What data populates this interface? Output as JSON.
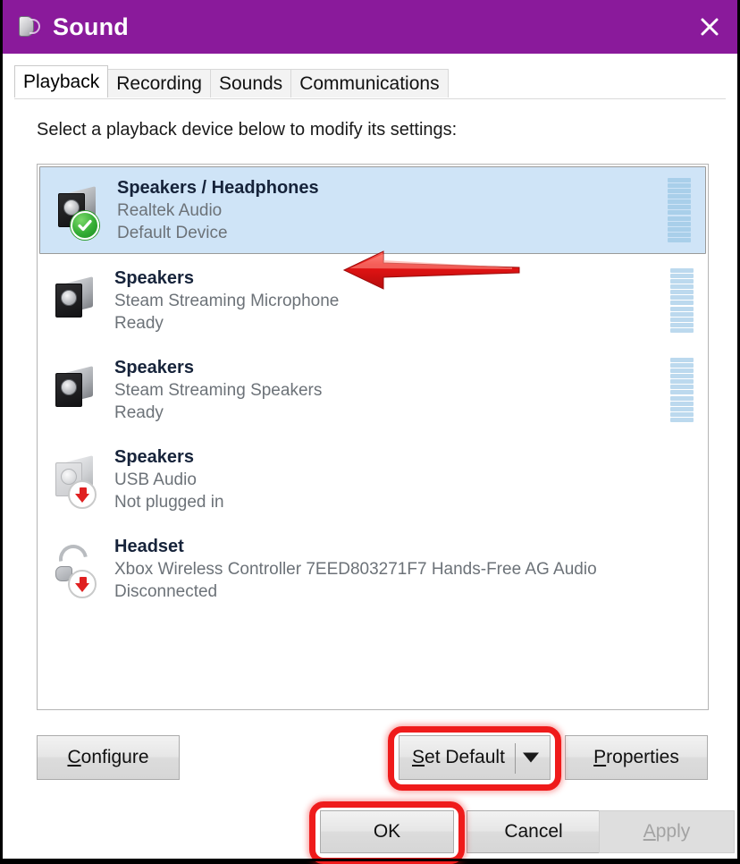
{
  "window": {
    "title": "Sound",
    "icon": "speaker-icon",
    "close_label": "✕",
    "accent_color": "#8a1a9b"
  },
  "tabs": [
    {
      "label": "Playback",
      "active": true
    },
    {
      "label": "Recording",
      "active": false
    },
    {
      "label": "Sounds",
      "active": false
    },
    {
      "label": "Communications",
      "active": false
    }
  ],
  "instruction": "Select a playback device below to modify its settings:",
  "devices": [
    {
      "name": "Speakers / Headphones",
      "driver": "Realtek Audio",
      "status": "Default Device",
      "icon": "speaker-icon",
      "badge": "green-check-icon",
      "selected": true,
      "meter_level": 12,
      "meter_strong": true
    },
    {
      "name": "Speakers",
      "driver": "Steam Streaming Microphone",
      "status": "Ready",
      "icon": "speaker-icon",
      "badge": "none",
      "selected": false,
      "meter_level": 12,
      "meter_strong": false
    },
    {
      "name": "Speakers",
      "driver": "Steam Streaming Speakers",
      "status": "Ready",
      "icon": "speaker-icon",
      "badge": "none",
      "selected": false,
      "meter_level": 12,
      "meter_strong": false
    },
    {
      "name": "Speakers",
      "driver": "USB Audio",
      "status": "Not plugged in",
      "icon": "speaker-disabled-icon",
      "badge": "red-down-arrow-icon",
      "selected": false,
      "meter_level": 0,
      "meter_strong": false
    },
    {
      "name": "Headset",
      "driver": "Xbox Wireless Controller 7EED803271F7 Hands-Free AG Audio",
      "status": "Disconnected",
      "icon": "headset-icon",
      "badge": "red-down-arrow-icon",
      "selected": false,
      "meter_level": 0,
      "meter_strong": false
    }
  ],
  "buttons": {
    "configure": {
      "label": "Configure",
      "accelerator": "C"
    },
    "set_default": {
      "label": "Set Default",
      "accelerator": "S",
      "has_dropdown": true,
      "highlighted": true
    },
    "properties": {
      "label": "Properties",
      "accelerator": "P"
    },
    "ok": {
      "label": "OK",
      "highlighted": true
    },
    "cancel": {
      "label": "Cancel"
    },
    "apply": {
      "label": "Apply",
      "accelerator": "A",
      "disabled": true
    }
  },
  "annotations": {
    "arrow": {
      "type": "red-left-arrow",
      "color": "#e01b1b",
      "points_to": "Speakers / Headphones"
    },
    "highlight_color": "#ef1b1b"
  }
}
